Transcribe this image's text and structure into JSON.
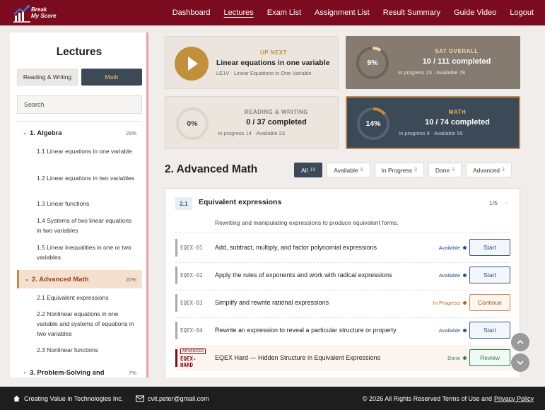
{
  "app": {
    "logo_text_line1": "Break",
    "logo_text_line2": "My Score",
    "brand_color": "#7b0b1e",
    "accent_color": "#c1903d",
    "dark_color": "#3c4a57"
  },
  "nav": {
    "items": [
      {
        "label": "Dashboard"
      },
      {
        "label": "Lectures",
        "active": true
      },
      {
        "label": "Exam List"
      },
      {
        "label": "Assignment List"
      },
      {
        "label": "Result Summary"
      },
      {
        "label": "Guide Video"
      },
      {
        "label": "Logout"
      }
    ]
  },
  "sidebar": {
    "title": "Lectures",
    "tabs": {
      "reading_writing": "Reading & Writing",
      "math": "Math",
      "active": "math"
    },
    "search_placeholder": "Search",
    "sections": [
      {
        "chev": "⌄",
        "label": "1.  Algebra",
        "pct": "29%",
        "expanded": true,
        "items": [
          {
            "label": "1.1  Linear equations in one variable"
          },
          {
            "label": "1.2  Linear equations in two variables"
          },
          {
            "label": "1.3  Linear functions"
          },
          {
            "label": "1.4  Systems of two linear equations in two variables"
          },
          {
            "label": "1.5  Linear inequalities in one or two variables"
          }
        ]
      },
      {
        "chev": "⌄",
        "label": "2.  Advanced Math",
        "pct": "20%",
        "expanded": true,
        "active": true,
        "items": [
          {
            "label": "2.1  Equivalent expressions"
          },
          {
            "label": "2.2  Nonlinear equations in one variable and systems of equations in two variables"
          },
          {
            "label": "2.3  Nonlinear functions"
          }
        ]
      },
      {
        "chev": "›",
        "label": "3.  Problem-Solving and",
        "pct": "7%",
        "expanded": false
      }
    ]
  },
  "cards": {
    "up_next": {
      "label": "UP NEXT",
      "title": "Linear equations in one variable",
      "subtitle": "LE1V · Linear Equations in One Variable"
    },
    "sat_overall": {
      "label": "SAT OVERALL",
      "percent": "9%",
      "fraction": 0.09,
      "count": "10 / 111 completed",
      "sub": "In progress 23 · Available 78"
    },
    "reading_writing": {
      "label": "READING & WRITING",
      "percent": "0%",
      "fraction": 0.0,
      "count": "0 / 37 completed",
      "sub": "In progress 14 · Available 23"
    },
    "math": {
      "label": "MATH",
      "percent": "14%",
      "fraction": 0.14,
      "count": "10 / 74 completed",
      "sub": "In progress 9 · Available 55"
    }
  },
  "section": {
    "title": "2. Advanced Math",
    "filters": [
      {
        "label": "All",
        "count": "15",
        "active": true
      },
      {
        "label": "Available",
        "count": "9"
      },
      {
        "label": "In Progress",
        "count": "3"
      },
      {
        "label": "Done",
        "count": "3"
      },
      {
        "label": "Advanced",
        "count": "3"
      }
    ]
  },
  "panel": {
    "number": "2.1",
    "title": "Equivalent expressions",
    "progress": "1/5",
    "caret": "⌄",
    "description": "Rewriting and manipulating expressions to produce equivalent forms.",
    "rows": [
      {
        "code": "EQEX-01",
        "text": "Add, subtract, multiply, and factor polynomial expressions",
        "status": "Available",
        "action": "Start"
      },
      {
        "code": "EQEX-02",
        "text": "Apply the rules of exponents and work with radical expressions",
        "status": "Available",
        "action": "Start"
      },
      {
        "code": "EQEX-03",
        "text": "Simplify and rewrite rational expressions",
        "status": "In Progress",
        "action": "Continue"
      },
      {
        "code": "EQEX-04",
        "text": "Rewrite an expression to reveal a particular structure or property",
        "status": "Available",
        "action": "Start"
      },
      {
        "code": "EQEX-HARD",
        "tag": "ADVANCED",
        "text": "EQEX Hard — Hidden Structure in Equivalent Expressions",
        "status": "Done",
        "action": "Review"
      }
    ]
  },
  "status_colors": {
    "Available": "#2f4f8f",
    "In Progress": "#b86a1c",
    "Done": "#2e7d4b"
  },
  "footer": {
    "company": "Creating Value in Technologies Inc.",
    "email": "cvit.peter@gmail.com",
    "copyright": "© 2026 All Rights Reserved Terms of Use and",
    "privacy": "Privacy Policy"
  }
}
